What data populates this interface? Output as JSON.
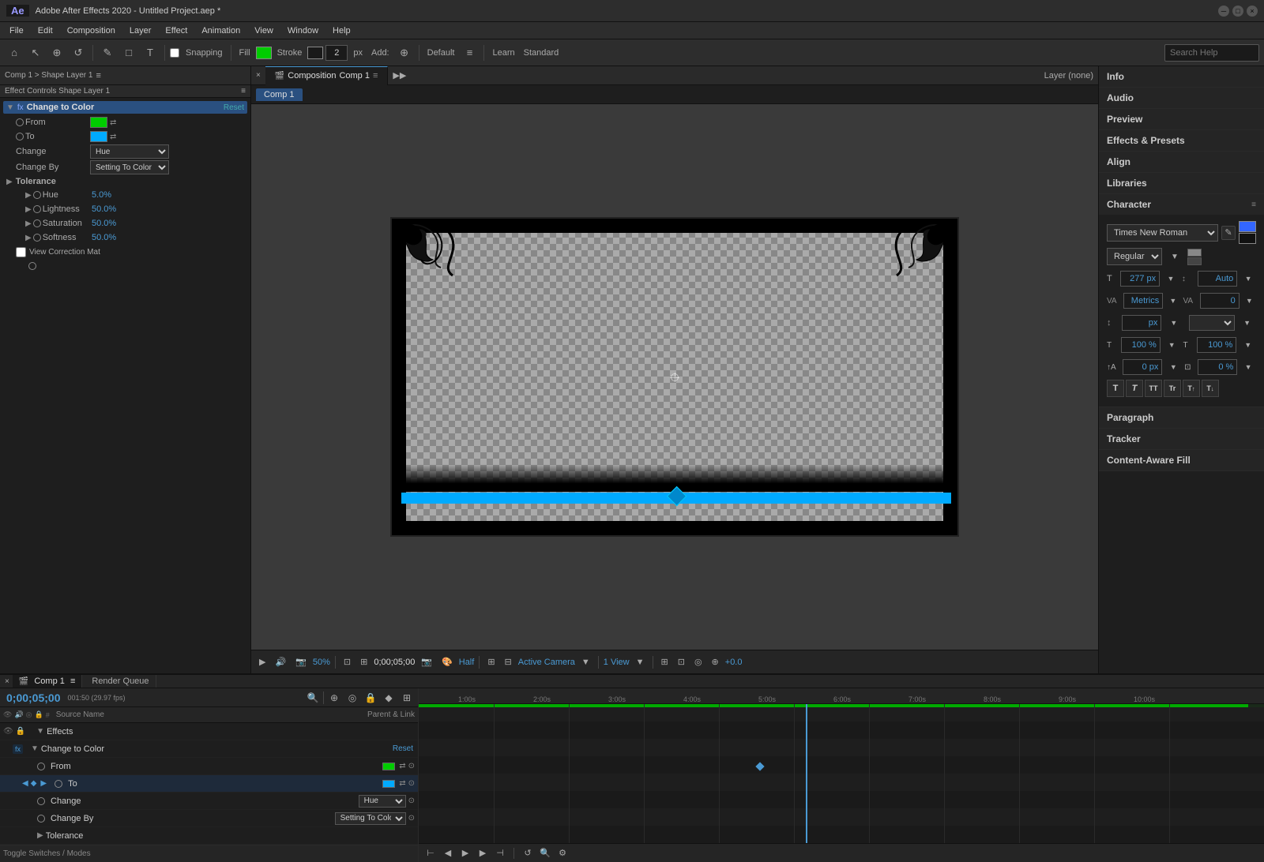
{
  "app": {
    "title": "Adobe After Effects 2020 - Untitled Project.aep *",
    "version": "AE"
  },
  "menu": {
    "items": [
      "File",
      "Edit",
      "Composition",
      "Layer",
      "Effect",
      "Animation",
      "View",
      "Window",
      "Help"
    ]
  },
  "toolbar": {
    "snapping_label": "Snapping",
    "fill_label": "Fill",
    "stroke_label": "Stroke",
    "stroke_px": "2 px",
    "add_label": "Add:",
    "default_label": "Default",
    "learn_label": "Learn",
    "standard_label": "Standard",
    "search_placeholder": "Search Help"
  },
  "left_panel": {
    "breadcrumb": "Comp 1 > Shape Layer 1",
    "panel_label": "Effect Controls Shape Layer 1",
    "effect_name": "Change to Color",
    "reset_label": "Reset",
    "from_label": "From",
    "to_label": "To",
    "change_label": "Change",
    "change_value": "Hue",
    "change_by_label": "Change By",
    "change_by_value": "Setting To Color",
    "tolerance_label": "Tolerance",
    "hue_label": "Hue",
    "hue_value": "5.0%",
    "lightness_label": "Lightness",
    "lightness_value": "50.0%",
    "saturation_label": "Saturation",
    "saturation_value": "50.0%",
    "softness_label": "Softness",
    "softness_value": "50.0%",
    "view_correction_label": "View Correction Mat"
  },
  "center": {
    "comp_tab": "Comp 1",
    "layer_label": "Layer (none)",
    "viewer_zoom": "50%",
    "viewer_time": "0;00;05;00",
    "viewer_quality": "Half",
    "viewer_view": "Active Camera",
    "viewer_views": "1 View",
    "viewer_offset": "+0.0"
  },
  "right_panel": {
    "info_label": "Info",
    "audio_label": "Audio",
    "preview_label": "Preview",
    "effects_presets_label": "Effects & Presets",
    "align_label": "Align",
    "libraries_label": "Libraries",
    "character_label": "Character",
    "tracker_label": "Tracker",
    "paragraph_label": "Paragraph",
    "content_aware_label": "Content-Aware Fill",
    "font_name": "Times New Roman",
    "font_style": "Regular",
    "font_size": "277 px",
    "font_size_auto": "Auto",
    "tracking_label": "Metrics",
    "kerning_value": "0",
    "line_height_value": "px",
    "horiz_scale": "100 %",
    "vert_scale": "100 %",
    "baseline_shift": "0 px",
    "tsume": "0 %"
  },
  "timeline": {
    "comp_tab": "Comp 1",
    "render_queue_tab": "Render Queue",
    "time_display": "0;00;05;00",
    "time_sub": "001:50 (29.97 fps)",
    "source_name_col": "Source Name",
    "parent_link_col": "Parent & Link",
    "layers": [
      {
        "name": "Effects",
        "type": "group",
        "indent": 0
      },
      {
        "name": "Change to Color",
        "type": "effect",
        "indent": 1,
        "reset": "Reset"
      },
      {
        "name": "From",
        "type": "property",
        "indent": 2,
        "color": "green"
      },
      {
        "name": "To",
        "type": "property",
        "indent": 2,
        "color": "blue"
      },
      {
        "name": "Change",
        "type": "property",
        "indent": 2,
        "value": "Hue"
      },
      {
        "name": "Change By",
        "type": "property",
        "indent": 2,
        "value": "Setting To Color"
      },
      {
        "name": "Tolerance",
        "type": "group",
        "indent": 2
      }
    ],
    "ruler_marks": [
      "1:00s",
      "2:00s",
      "3:00s",
      "4:00s",
      "5:00s",
      "6:00s",
      "7:00s",
      "8:00s",
      "9:00s",
      "10:00s"
    ],
    "toggle_switches_label": "Toggle Switches / Modes",
    "change_by_row_label": "Change By"
  }
}
